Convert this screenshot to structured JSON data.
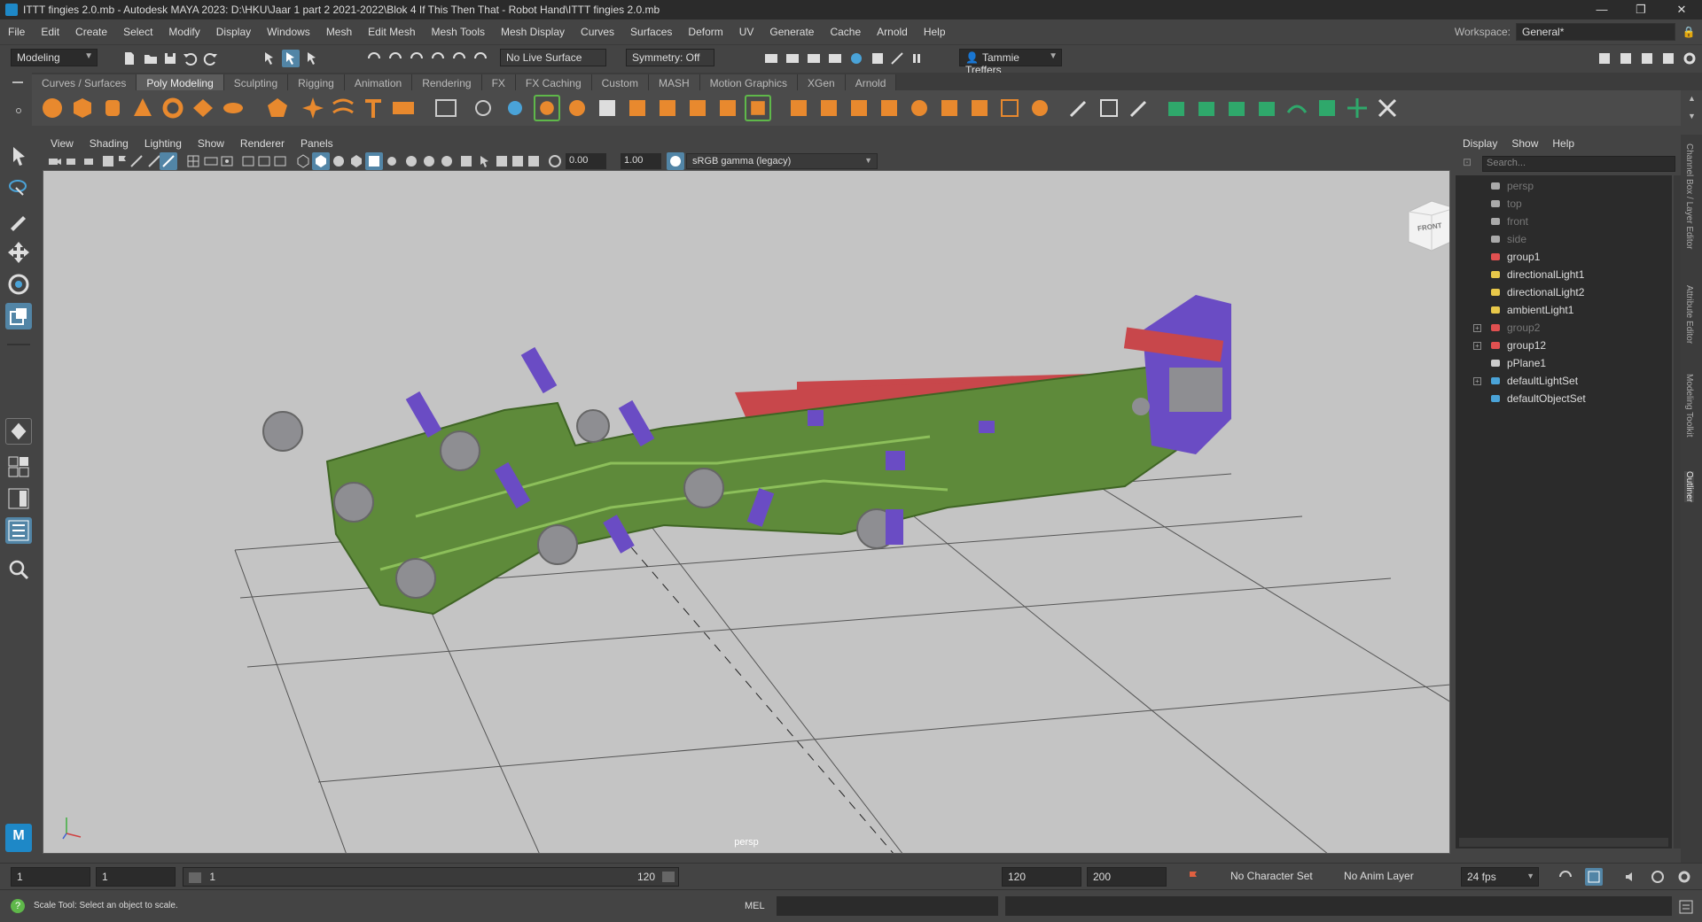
{
  "window": {
    "title": "ITTT fingies 2.0.mb - Autodesk MAYA 2023: D:\\HKU\\Jaar 1 part 2 2021-2022\\Blok 4 If This Then That - Robot Hand\\ITTT fingies 2.0.mb",
    "minimize": "—",
    "restore": "❐",
    "close": "✕"
  },
  "menu": [
    "File",
    "Edit",
    "Create",
    "Select",
    "Modify",
    "Display",
    "Windows",
    "Mesh",
    "Edit Mesh",
    "Mesh Tools",
    "Mesh Display",
    "Curves",
    "Surfaces",
    "Deform",
    "UV",
    "Generate",
    "Cache",
    "Arnold",
    "Help"
  ],
  "workspace": {
    "label": "Workspace:",
    "value": "General*"
  },
  "statusline": {
    "mode": "Modeling",
    "live_surface": "No Live Surface",
    "symmetry": "Symmetry: Off",
    "user": "Tammie Treffers"
  },
  "shelf_tabs": [
    "Curves / Surfaces",
    "Poly Modeling",
    "Sculpting",
    "Rigging",
    "Animation",
    "Rendering",
    "FX",
    "FX Caching",
    "Custom",
    "MASH",
    "Motion Graphics",
    "XGen",
    "Arnold"
  ],
  "shelf_active": "Poly Modeling",
  "viewport": {
    "menu": [
      "View",
      "Shading",
      "Lighting",
      "Show",
      "Renderer",
      "Panels"
    ],
    "exposure": "0.00",
    "gamma": "1.00",
    "color_space": "sRGB gamma (legacy)",
    "camera_label": "persp",
    "viewcube_label": "FRONT"
  },
  "outliner": {
    "menu": [
      "Display",
      "Show",
      "Help"
    ],
    "search_placeholder": "Search...",
    "items": [
      {
        "name": "persp",
        "icon": "camera-icon",
        "dim": true,
        "expand": false
      },
      {
        "name": "top",
        "icon": "camera-icon",
        "dim": true,
        "expand": false
      },
      {
        "name": "front",
        "icon": "camera-icon",
        "dim": true,
        "expand": false
      },
      {
        "name": "side",
        "icon": "camera-icon",
        "dim": true,
        "expand": false
      },
      {
        "name": "group1",
        "icon": "group-icon",
        "dim": false,
        "expand": false
      },
      {
        "name": "directionalLight1",
        "icon": "directional-light-icon",
        "dim": false,
        "expand": false
      },
      {
        "name": "directionalLight2",
        "icon": "directional-light-icon",
        "dim": false,
        "expand": false
      },
      {
        "name": "ambientLight1",
        "icon": "ambient-light-icon",
        "dim": false,
        "expand": false
      },
      {
        "name": "group2",
        "icon": "group-icon",
        "dim": true,
        "expand": true
      },
      {
        "name": "group12",
        "icon": "group-icon",
        "dim": false,
        "expand": true
      },
      {
        "name": "pPlane1",
        "icon": "mesh-icon",
        "dim": false,
        "expand": false
      },
      {
        "name": "defaultLightSet",
        "icon": "set-icon",
        "dim": false,
        "expand": true
      },
      {
        "name": "defaultObjectSet",
        "icon": "set-icon",
        "dim": false,
        "expand": false
      }
    ]
  },
  "side_tabs": [
    "Channel Box / Layer Editor",
    "Attribute Editor",
    "Modeling Toolkit",
    "Outliner"
  ],
  "timeline": {
    "start": "1",
    "current": "1",
    "range_start": "1",
    "range_end_slider": "120",
    "end": "120",
    "anim_end": "200",
    "character_set": "No Character Set",
    "anim_layer": "No Anim Layer",
    "fps": "24 fps"
  },
  "help": {
    "message": "Scale Tool: Select an object to scale.",
    "mel_label": "MEL"
  },
  "colors": {
    "accent": "#5285a6",
    "viewport_bg": "#c4c4c4",
    "mesh_green": "#5e8a3a",
    "mesh_red": "#c8474b",
    "mesh_purple": "#6a4cc4",
    "mesh_grey": "#8e8e92"
  }
}
